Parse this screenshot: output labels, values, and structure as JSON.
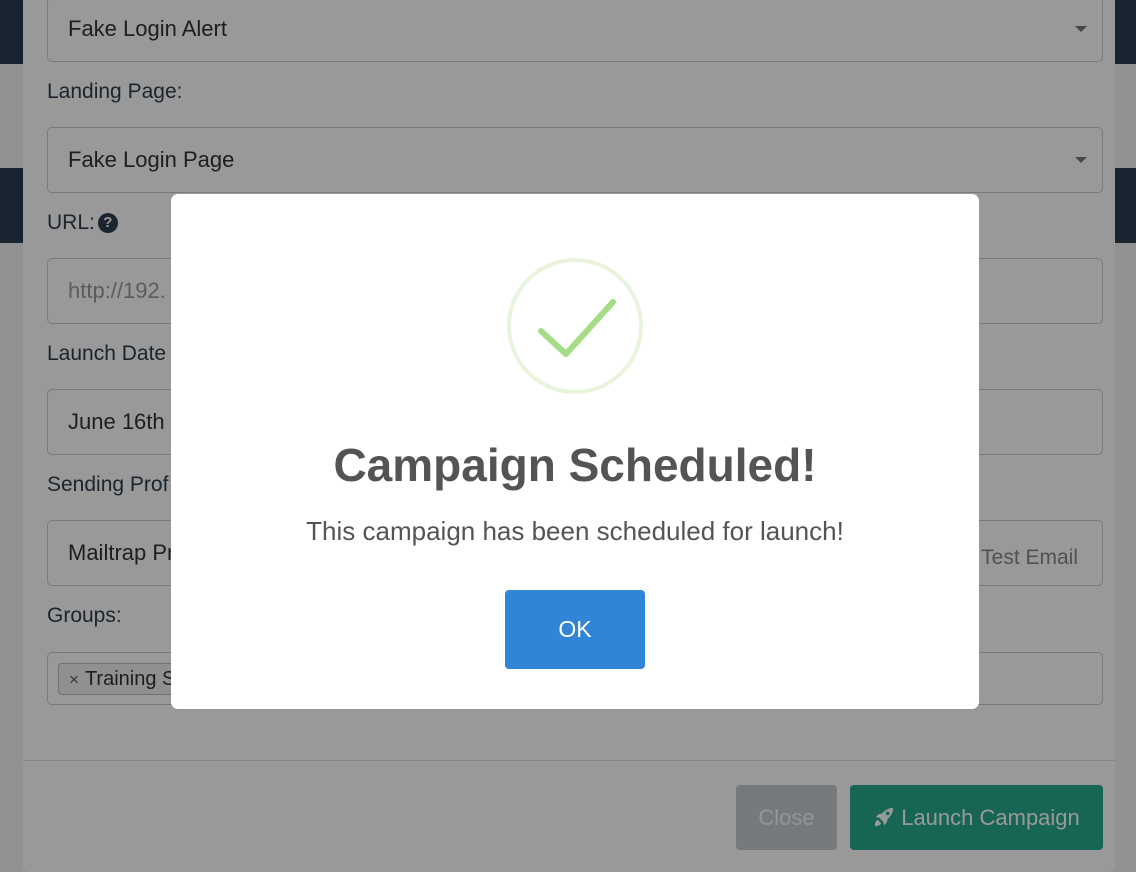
{
  "form": {
    "template_value": "Fake Login Alert",
    "landing_page_label": "Landing Page:",
    "landing_page_value": "Fake Login Page",
    "url_label": "URL:",
    "url_placeholder": "http://192.",
    "launch_date_label": "Launch Date",
    "launch_date_value": "June 16th :",
    "sending_profile_label": "Sending Prof",
    "sending_profile_value": "Mailtrap Pr",
    "send_test_label": "Test Email",
    "groups_label": "Groups:",
    "group_tag": "Training S",
    "group_tag_remove": "×"
  },
  "footer": {
    "close_label": "Close",
    "launch_label": "Launch Campaign"
  },
  "alert": {
    "title": "Campaign Scheduled!",
    "text": "This campaign has been scheduled for launch!",
    "ok_label": "OK",
    "icon": "success-check-icon"
  },
  "colors": {
    "ok_button": "#3085d6",
    "launch_button": "#27a98c",
    "success_check": "#a5dc86"
  }
}
